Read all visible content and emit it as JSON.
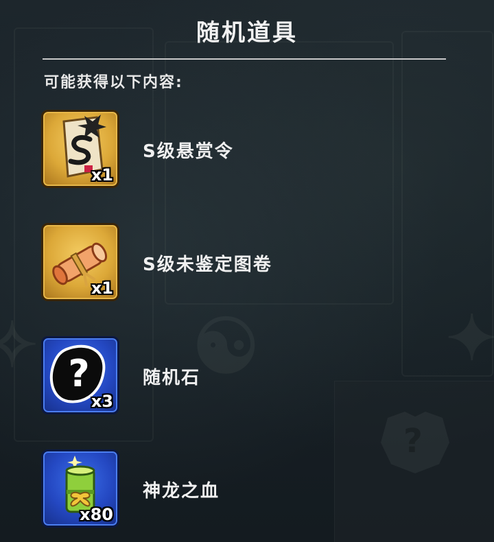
{
  "dialog": {
    "title": "随机道具",
    "intro": "可能获得以下内容:"
  },
  "items": [
    {
      "name": "S级悬赏令",
      "qty": "x1",
      "icon": "bounty-scroll-icon",
      "frame": "gold"
    },
    {
      "name": "S级未鉴定图卷",
      "qty": "x1",
      "icon": "rolled-scroll-icon",
      "frame": "gold"
    },
    {
      "name": "随机石",
      "qty": "x3",
      "icon": "mystery-stone-icon",
      "frame": "blue"
    },
    {
      "name": "神龙之血",
      "qty": "x80",
      "icon": "dragon-blood-bamboo-icon",
      "frame": "blue"
    }
  ],
  "colors": {
    "gold_frame": "#dca838",
    "blue_frame": "#2448c2",
    "text": "#f0f0f0",
    "background": "#1a2228"
  }
}
